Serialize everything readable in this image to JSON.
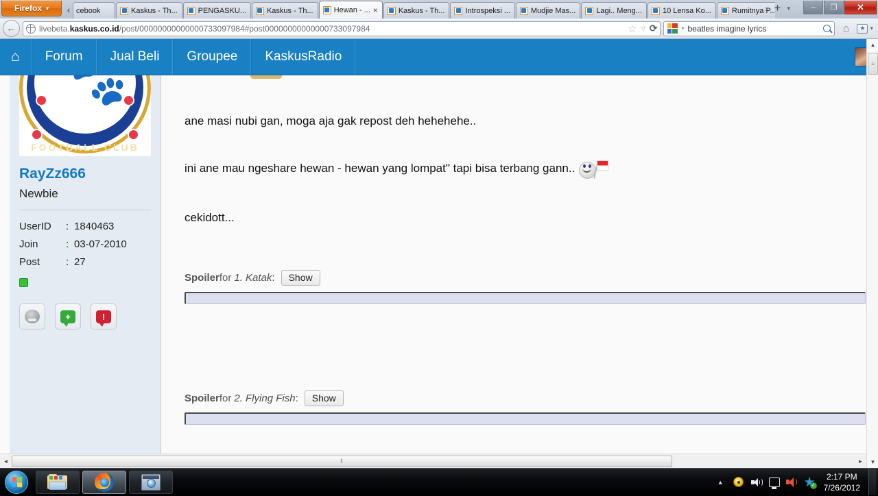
{
  "browser": {
    "firefox_button": "Firefox",
    "tabs": [
      {
        "label": "cebook",
        "active": false,
        "partial": true,
        "favicon": "none"
      },
      {
        "label": "Kaskus - Th...",
        "active": false,
        "favicon": "kaskus-favicon"
      },
      {
        "label": "PENGASKU...",
        "active": false,
        "favicon": "kaskus-favicon"
      },
      {
        "label": "Kaskus - Th...",
        "active": false,
        "favicon": "kaskus-favicon"
      },
      {
        "label": "Hewan - ...",
        "active": true,
        "favicon": "kaskus-favicon",
        "close": "×"
      },
      {
        "label": "Kaskus - Th...",
        "active": false,
        "favicon": "kaskus-favicon"
      },
      {
        "label": "Introspeksi ...",
        "active": false,
        "favicon": "kaskus-favicon"
      },
      {
        "label": "Mudjie Mas...",
        "active": false,
        "favicon": "kaskus-favicon"
      },
      {
        "label": "Lagi.. Meng...",
        "active": false,
        "favicon": "kaskus-favicon"
      },
      {
        "label": "10 Lensa Ko...",
        "active": false,
        "favicon": "kaskus-favicon"
      },
      {
        "label": "Rumitnya P...",
        "active": false,
        "favicon": "kaskus-favicon"
      }
    ],
    "tab_scroll_left": "‹",
    "tab_scroll_right": "›",
    "new_tab": "+",
    "tab_list": "▾",
    "window_controls": {
      "minimize": "–",
      "maximize": "❐",
      "close": "✕"
    },
    "back_button": "←",
    "url": {
      "prefix": "livebeta.",
      "domain": "kaskus.co.id",
      "path": "/post/00000000000000733097984#post00000000000000733097984",
      "full": "livebeta.kaskus.co.id/post/00000000000000733097984#post00000000000000733097984"
    },
    "url_icons": {
      "bookmark_star": "☆",
      "dropdown": "▽",
      "reload": "⟳"
    },
    "search": {
      "value": "beatles imagine lyrics",
      "engine": "google-logo",
      "dropdown": "▾"
    },
    "home_button": "⌂",
    "bookmarks_button": "★",
    "bookmarks_caret": "▾"
  },
  "site_nav": {
    "home_icon": "⌂",
    "items": [
      {
        "label": "Forum"
      },
      {
        "label": "Jual Beli"
      },
      {
        "label": "Groupee"
      },
      {
        "label": "KaskusRadio"
      }
    ],
    "accent_color": "#1980c4"
  },
  "sidebar": {
    "avatar_alt": "Chelsea Football Club crest",
    "crest_text": "FOOTBALL CLUB",
    "username": "RayZz666",
    "user_title": "Newbie",
    "stats": [
      {
        "key": "UserID",
        "sep": ":",
        "value": "1840463"
      },
      {
        "key": "Join",
        "sep": ":",
        "value": "03-07-2010"
      },
      {
        "key": "Post",
        "sep": ":",
        "value": "27"
      }
    ],
    "online_status_color": "#3dc13d",
    "actions": [
      {
        "name": "user-profile-icon"
      },
      {
        "name": "give-reputation-icon",
        "glyph": "+"
      },
      {
        "name": "report-post-icon",
        "glyph": "!"
      }
    ]
  },
  "post": {
    "lines": [
      "ane masi nubi gan, moga aja gak repost deh hehehehe..",
      "ini ane mau ngeshare hewan - hewan yang lompat\" tapi bisa terbang gann..",
      "cekidott..."
    ],
    "emoticon": "smiley-with-indonesian-flag",
    "spoilers": [
      {
        "label": "Spoiler",
        "for": "for",
        "title": "1. Katak",
        "colon": ":",
        "button": "Show"
      },
      {
        "label": "Spoiler",
        "for": "for",
        "title": "2. Flying Fish",
        "colon": ":",
        "button": "Show"
      }
    ]
  },
  "scrollbars": {
    "v_up": "▲",
    "v_down": "▼",
    "v_grip": "≡",
    "h_left": "◄",
    "h_right": "►",
    "h_grip": "‖"
  },
  "taskbar": {
    "start": "start-orb",
    "buttons": [
      {
        "name": "windows-explorer",
        "icon": "folder-icon",
        "active": false
      },
      {
        "name": "firefox",
        "icon": "firefox-icon",
        "active": true
      },
      {
        "name": "windows-media-player",
        "icon": "media-player-icon",
        "active": false
      }
    ],
    "tray": {
      "expand": "▲",
      "icons": [
        "disc-icon",
        "speaker-icon",
        "network-icon",
        "volume-icon",
        "security-shield-icon"
      ],
      "shield_check": "✓"
    },
    "time": "2:17 PM",
    "date": "7/26/2012"
  }
}
